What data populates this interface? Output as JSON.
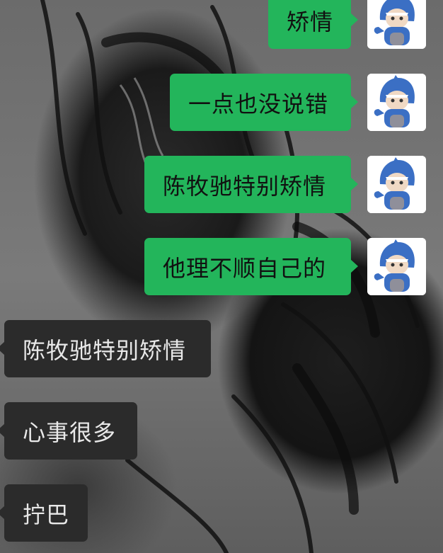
{
  "chat": {
    "messages": [
      {
        "side": "sent",
        "text": "矫情"
      },
      {
        "side": "sent",
        "text": "一点也没说错"
      },
      {
        "side": "sent",
        "text": "陈牧驰特别矫情"
      },
      {
        "side": "sent",
        "text": "他理不顺自己的"
      },
      {
        "side": "received",
        "text": "陈牧驰特别矫情"
      },
      {
        "side": "received",
        "text": "心事很多"
      },
      {
        "side": "received",
        "text": "拧巴"
      }
    ]
  },
  "avatar": {
    "icon": "shark-costume-doll-icon"
  },
  "colors": {
    "sent_bubble": "#23b55b",
    "received_bubble": "#2b2b2b",
    "background": "#6e6e6e"
  }
}
